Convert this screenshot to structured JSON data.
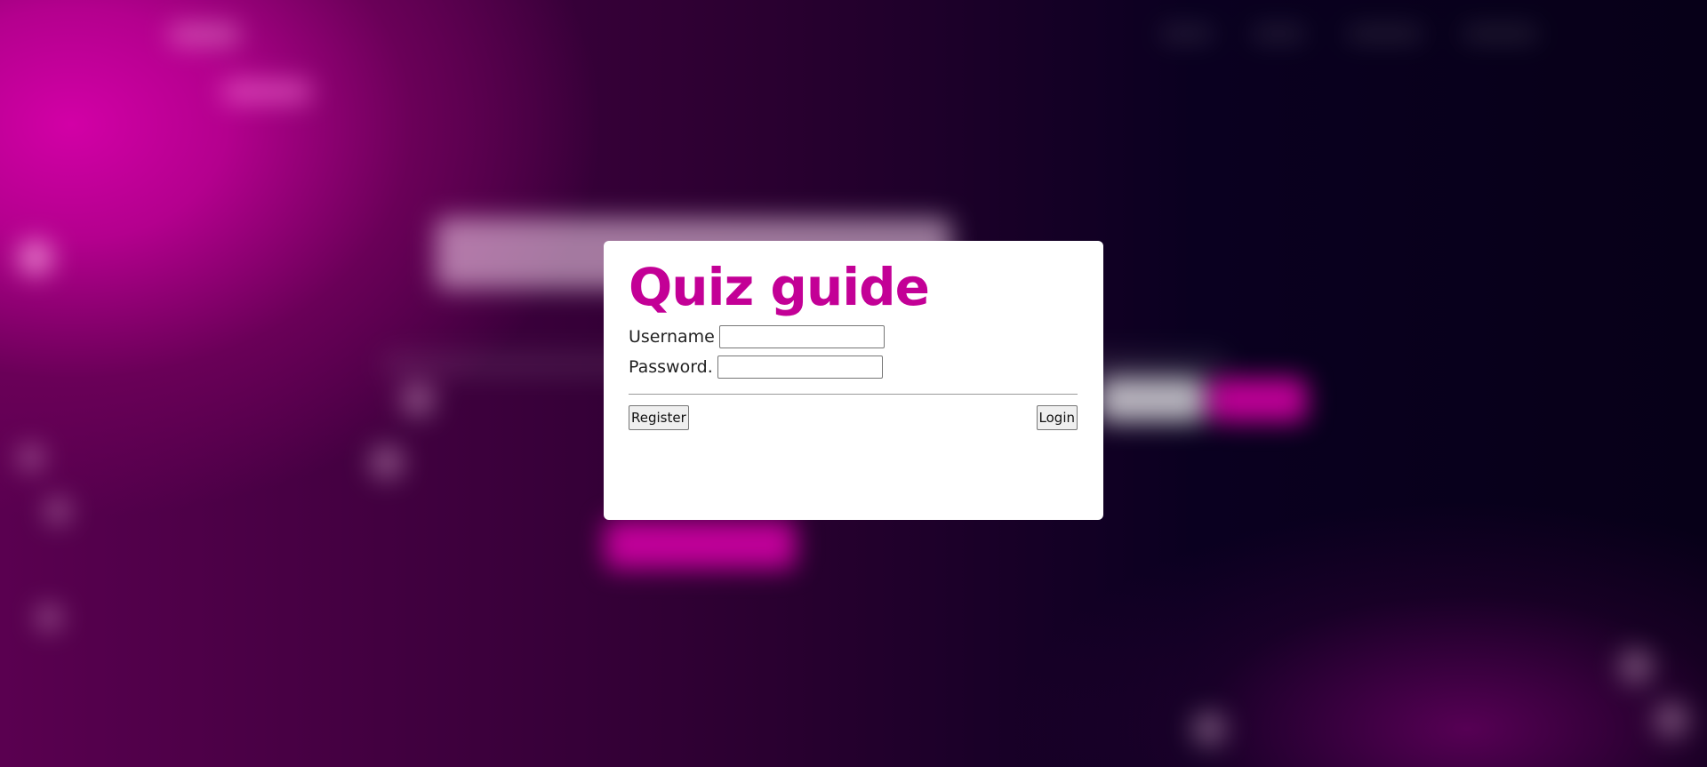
{
  "background": {
    "primary_color": "#c30096",
    "dark_color": "#070018"
  },
  "modal": {
    "title": "Quiz guide",
    "username_label": "Username",
    "username_value": "",
    "password_label": "Password.",
    "password_value": "",
    "register_label": "Register",
    "login_label": "Login"
  }
}
